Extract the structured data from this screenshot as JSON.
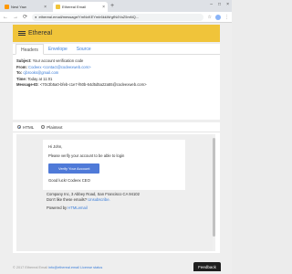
{
  "browser": {
    "tabs": [
      {
        "label": "Nest Yaw",
        "close": "×"
      },
      {
        "label": "Ethereal Email",
        "close": "×"
      }
    ],
    "new_tab": "+",
    "window_buttons": [
      "–",
      "□",
      "×"
    ],
    "address": "ethereal.email/message/YmNxKEYmlr6kkWrgfN4YaZ5mNQ...",
    "nav": [
      "←",
      "→",
      "⟳"
    ],
    "lock": "🔒",
    "menu": "⋮"
  },
  "app": {
    "brand": "Ethereal"
  },
  "message_tabs": [
    "Headers",
    "Envelope",
    "Source"
  ],
  "headers": {
    "subject_label": "Subject:",
    "subject": "Your account verification code",
    "from_label": "From:",
    "from": "Codeex <contact@codeexweb.com>",
    "to_label": "To:",
    "to": "cjbrooks@gmail.com",
    "time_label": "Time:",
    "time": "Today at 11:01",
    "message_id_label": "Message-ID:",
    "message_id": "<70c3b5a0-bfeb-c1e7-f60b-64d5d5a22a55@codeexweb.com>"
  },
  "viewer": {
    "html_label": "HTML",
    "plaintext_label": "Plaintext"
  },
  "email": {
    "greeting": "Hi John,",
    "body": "Please verify your account to be able to login",
    "button": "Verify Your Account",
    "signoff": "Good luck! Codeex CEO",
    "address": "Company Inc, 3 Abbey Road, San Francisco CA 94102",
    "unsubscribe_prefix": "Don't like these emails?",
    "unsubscribe_link": "Unsubscribe.",
    "powered_prefix": "Powered by",
    "powered_link": "HTMLemail"
  },
  "page_footer": {
    "copyright": "© 2017 Ethereal Email",
    "contact": "info@ethereal.email",
    "license": "License",
    "status": "status"
  },
  "feedback": "Feedback"
}
